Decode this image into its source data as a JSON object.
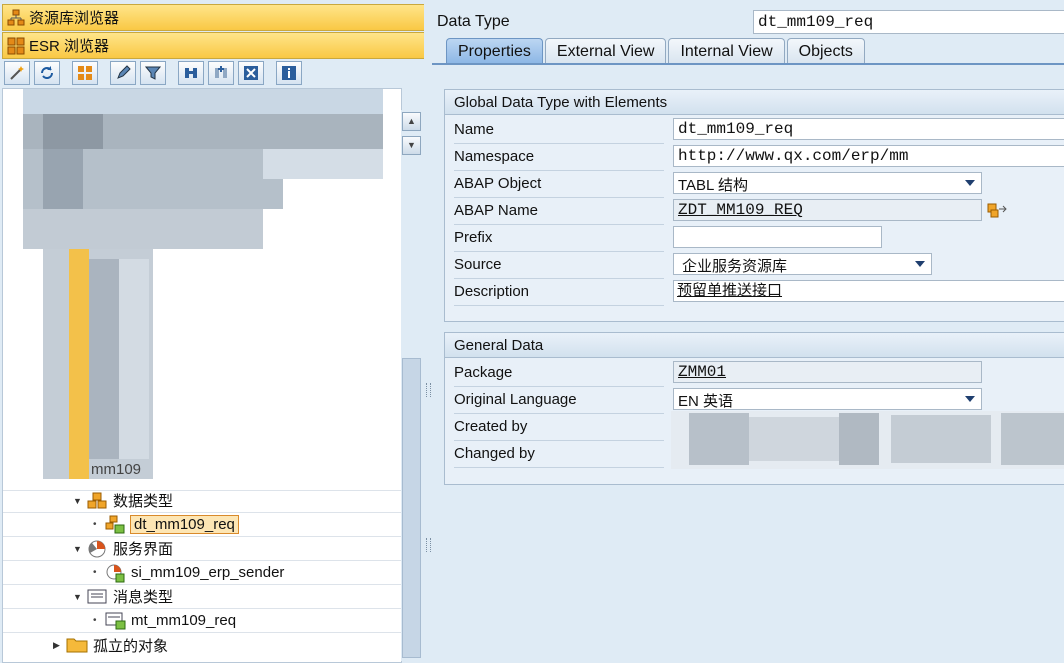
{
  "left_nav": {
    "repository_browser": "资源库浏览器",
    "esr_browser": "ESR 浏览器"
  },
  "toolbar": {
    "icons": [
      "wand-icon",
      "refresh-icon",
      "hierarchy-icon",
      "pen-icon",
      "filter-icon",
      "binoculars-icon",
      "add-binoculars-icon",
      "close-icon",
      "info-icon"
    ]
  },
  "tree": {
    "partial_label": "mm109",
    "nodes": [
      {
        "label": "数据类型",
        "icon": "data-type-folder-icon"
      },
      {
        "label": "dt_mm109_req",
        "icon": "data-type-icon",
        "selected": true
      },
      {
        "label": "服务界面",
        "icon": "service-interface-folder-icon"
      },
      {
        "label": "si_mm109_erp_sender",
        "icon": "service-interface-icon"
      },
      {
        "label": "消息类型",
        "icon": "message-type-folder-icon"
      },
      {
        "label": "mt_mm109_req",
        "icon": "message-type-icon"
      },
      {
        "label": "孤立的对象",
        "icon": "folder-icon"
      }
    ]
  },
  "header": {
    "object_type_label": "Data Type",
    "object_name": "dt_mm109_req"
  },
  "tabs": [
    {
      "label": "Properties",
      "active": true
    },
    {
      "label": "External View"
    },
    {
      "label": "Internal View"
    },
    {
      "label": "Objects"
    }
  ],
  "global_group": {
    "title": "Global Data Type with Elements",
    "fields": {
      "name": {
        "label": "Name",
        "value": "dt_mm109_req"
      },
      "namespace": {
        "label": "Namespace",
        "value": "http://www.qx.com/erp/mm"
      },
      "abap_object": {
        "label": "ABAP Object",
        "value": "TABL 结构"
      },
      "abap_name": {
        "label": "ABAP Name",
        "value": "ZDT_MM109_REQ"
      },
      "prefix": {
        "label": "Prefix",
        "value": ""
      },
      "source": {
        "label": "Source",
        "value": "企业服务资源库"
      },
      "description": {
        "label": "Description",
        "value": "预留单推送接口"
      }
    }
  },
  "general_group": {
    "title": "General Data",
    "fields": {
      "package": {
        "label": "Package",
        "value": "ZMM01"
      },
      "original_language": {
        "label": "Original Language",
        "value": "EN 英语"
      },
      "created_by": {
        "label": "Created by"
      },
      "changed_by": {
        "label": "Changed by"
      }
    }
  },
  "colors": {
    "nav_bar": "#f9c844",
    "active_tab": "#8bb6e5",
    "selection": "#fde6b4",
    "background": "#dfebf5"
  }
}
